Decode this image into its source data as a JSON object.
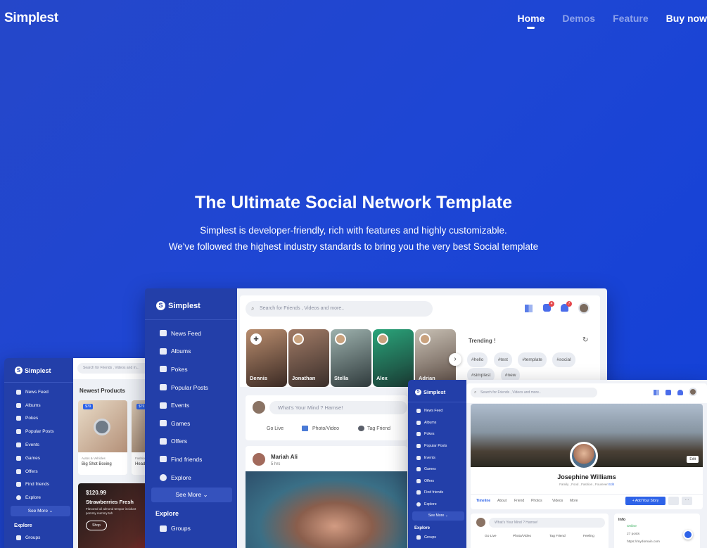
{
  "header": {
    "brand": "Simplest",
    "nav": [
      "Home",
      "Demos",
      "Feature",
      "Buy now"
    ]
  },
  "hero": {
    "title": "The Ultimate Social Network Template",
    "line1": "Simplest is developer-friendly, rich with features and highly customizable.",
    "line2": "We've followed the highest industry standards to bring you the very best Social template"
  },
  "main_mock": {
    "brand": "Simplest",
    "search_placeholder": "Search for Friends , Videos and more..",
    "badges": [
      "4",
      "7"
    ],
    "sidebar": [
      "News Feed",
      "Albums",
      "Pokes",
      "Popular Posts",
      "Events",
      "Games",
      "Offers",
      "Find friends",
      "Explore"
    ],
    "see_more": "See More",
    "explore": "Explore",
    "groups": "Groups",
    "stories": [
      "Dennis",
      "Jonathan",
      "Stella",
      "Alex",
      "Adrian"
    ],
    "trending_title": "Trending !",
    "tags": [
      "#hello",
      "#test",
      "#template",
      "#social",
      "#simplest",
      "#new"
    ],
    "composer_placeholder": "What's Your Mind ? Hamse!",
    "actions": [
      "Go Live",
      "Photo/Video",
      "Tag Friend"
    ],
    "post_author": "Mariah Ali",
    "post_time": "5 hrs"
  },
  "left_mock": {
    "brand": "Simplest",
    "search_placeholder": "Search for Friends , Videos and m...",
    "sidebar": [
      "News Feed",
      "Albums",
      "Pokes",
      "Popular Posts",
      "Events",
      "Games",
      "Offers",
      "Find friends",
      "Explore"
    ],
    "see_more": "See More",
    "explore": "Explore",
    "groups": "Groups",
    "section_title": "Newest Products",
    "price_tags": [
      "$79",
      "$79"
    ],
    "product1_category": "Autos & Vehicles",
    "product1_name": "Big Shot Boxing",
    "product2_category": "Fashion",
    "product2_name": "Headpho...",
    "promo_price": "$120.99",
    "promo_title": "Strawberries Fresh",
    "promo_desc": "Flavored oil almond tempor incidunt pommy nummy tah",
    "promo_button": "Shop"
  },
  "right_mock": {
    "brand": "Simplest",
    "search_placeholder": "Search for Friends , Videos and more..",
    "sidebar": [
      "News Feed",
      "Albums",
      "Pokes",
      "Popular Posts",
      "Events",
      "Games",
      "Offers",
      "Find friends",
      "Explore"
    ],
    "see_more": "See More",
    "explore": "Explore",
    "groups": "Groups",
    "profile_name": "Josephine Williams",
    "profile_tags": "Family , Food , Fashion , Fourever",
    "profile_edit_link": "Edit",
    "cover_edit": "Edit",
    "tabs": [
      "Timeline",
      "About",
      "Friend",
      "Photos",
      "Videos",
      "More"
    ],
    "add_story": "Add Your Story",
    "composer_placeholder": "What's Your Mind ? Hamse!",
    "actions": [
      "Go Live",
      "Photo/Video",
      "Tag Friend",
      "Feeling"
    ],
    "info_title": "Info",
    "info": [
      "Online",
      "27 posts",
      "https://mydomain.com"
    ]
  },
  "colors": {
    "background": "#1e46d4",
    "sidebar": "#233fa9",
    "accent": "#2e63e8"
  }
}
